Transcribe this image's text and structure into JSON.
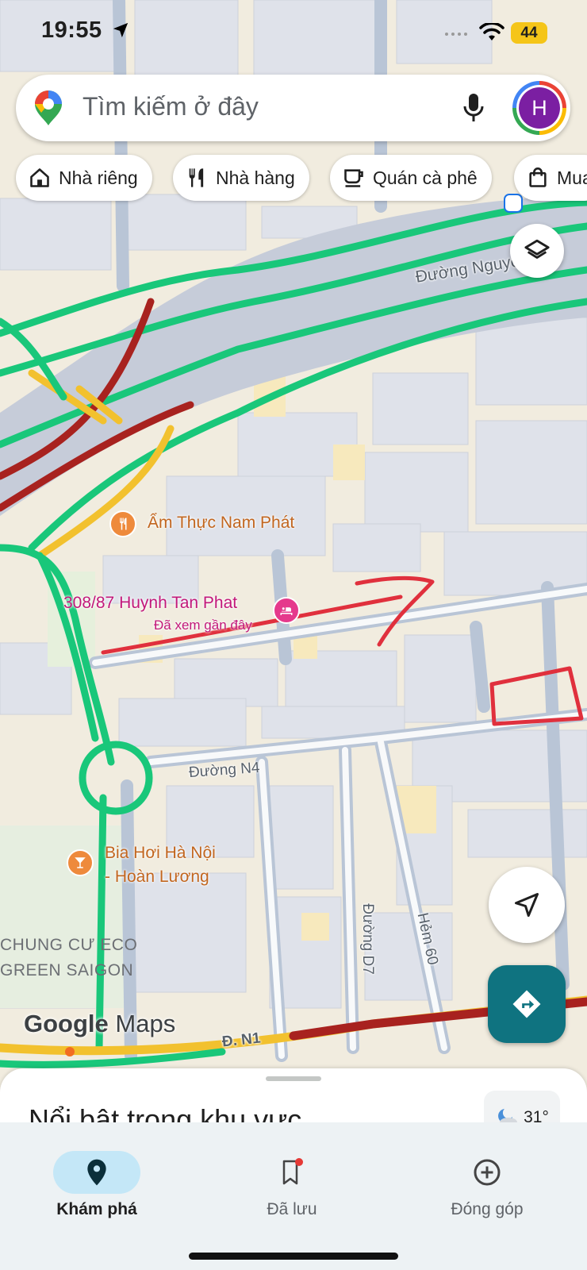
{
  "status_bar": {
    "time": "19:55",
    "battery": "44"
  },
  "search": {
    "placeholder": "Tìm kiếm ở đây",
    "avatar_letter": "H"
  },
  "chips": [
    {
      "label": "Nhà riêng",
      "icon": "home-icon"
    },
    {
      "label": "Nhà hàng",
      "icon": "restaurant-icon"
    },
    {
      "label": "Quán cà phê",
      "icon": "coffee-icon"
    },
    {
      "label": "Mua",
      "icon": "shopping-bag-icon"
    }
  ],
  "map": {
    "streets": {
      "nguyen_van": "Đường Nguyễn Văn",
      "n4": "Đường N4",
      "d7": "Đường D7",
      "hem60": "Hẻm 60",
      "n1": "Đ. N1"
    },
    "pois": {
      "restaurant": "Ẩm Thực Nam Phát",
      "saved_place": "308/87 Huynh Tan Phat",
      "saved_place_sub": "Đã xem gần đây",
      "bar_line1": "Bia Hơi Hà Nội",
      "bar_line2": "- Hoàn Lương",
      "complex_line1": "CHUNG CƯ ECO",
      "complex_line2": "GREEN SAIGON"
    },
    "traffic_colors": {
      "free": "#19c77a",
      "slow": "#f2c12e",
      "heavy": "#a8221f"
    },
    "annotation_color": "#e0303d"
  },
  "wordmark": {
    "google": "Google",
    "maps": "Maps"
  },
  "sheet": {
    "title": "Nổi bật trong khu vực",
    "weather": "31°"
  },
  "nav": {
    "explore": "Khám phá",
    "saved": "Đã lưu",
    "contribute": "Đóng góp"
  },
  "colors": {
    "accent": "#0f7380",
    "pin_pink": "#e5398c",
    "pin_orange": "#ee8a3c"
  }
}
